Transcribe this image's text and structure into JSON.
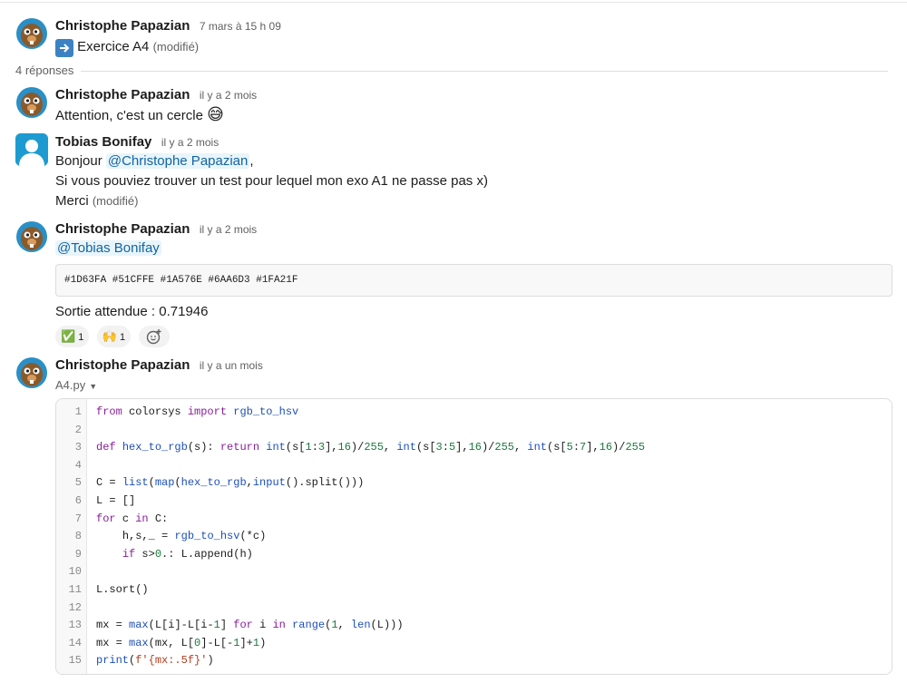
{
  "thread": {
    "parent": {
      "author": "Christophe Papazian",
      "time": "7 mars à 15 h 09",
      "icon": "arrow-right-emoji",
      "text": "Exercice A4",
      "edited": "(modifié)"
    },
    "replies_label": "4 réponses",
    "messages": [
      {
        "author": "Christophe Papazian",
        "time": "il y a 2 mois",
        "text": "Attention, c'est un cercle",
        "emoji": "😅"
      },
      {
        "author": "Tobias Bonifay",
        "time": "il y a 2 mois",
        "line1_prefix": "Bonjour ",
        "mention": "@Christophe Papazian",
        "line1_suffix": ",",
        "line2": "Si vous pouviez trouver un test pour lequel mon exo A1 ne passe pas x)",
        "line3": "Merci",
        "edited": "(modifié)"
      },
      {
        "author": "Christophe Papazian",
        "time": "il y a 2 mois",
        "mention": "@Tobias Bonifay",
        "snippet": "#1D63FA #51CFFE #1A576E #6AA6D3 #1FA21F",
        "text": "Sortie attendue : 0.71946",
        "reactions": [
          {
            "emoji": "✅",
            "count": "1"
          },
          {
            "emoji": "🙌",
            "count": "1"
          }
        ],
        "add_reaction_icon": "add-emoji-icon"
      },
      {
        "author": "Christophe Papazian",
        "time": "il y a un mois",
        "file_name": "A4.py",
        "code_lines": [
          {
            "n": "1",
            "code": "from colorsys import rgb_to_hsv"
          },
          {
            "n": "2",
            "code": ""
          },
          {
            "n": "3",
            "code": "def hex_to_rgb(s): return int(s[1:3],16)/255, int(s[3:5],16)/255, int(s[5:7],16)/255"
          },
          {
            "n": "4",
            "code": ""
          },
          {
            "n": "5",
            "code": "C = list(map(hex_to_rgb,input().split()))"
          },
          {
            "n": "6",
            "code": "L = []"
          },
          {
            "n": "7",
            "code": "for c in C:"
          },
          {
            "n": "8",
            "code": "    h,s,_ = rgb_to_hsv(*c)"
          },
          {
            "n": "9",
            "code": "    if s>0.: L.append(h)"
          },
          {
            "n": "10",
            "code": ""
          },
          {
            "n": "11",
            "code": "L.sort()"
          },
          {
            "n": "12",
            "code": ""
          },
          {
            "n": "13",
            "code": "mx = max(L[i]-L[i-1] for i in range(1, len(L)))"
          },
          {
            "n": "14",
            "code": "mx = max(mx, L[0]-L[-1]+1)"
          },
          {
            "n": "15",
            "code": "print(f'{mx:.5f}')"
          }
        ]
      }
    ]
  },
  "colors": {
    "mention_bg": "#e8f5fa",
    "mention_text": "#1264a3",
    "keyword": "#8a1d9a",
    "function": "#1d4fb8",
    "number": "#1a7a3c",
    "string": "#b33c1d"
  }
}
